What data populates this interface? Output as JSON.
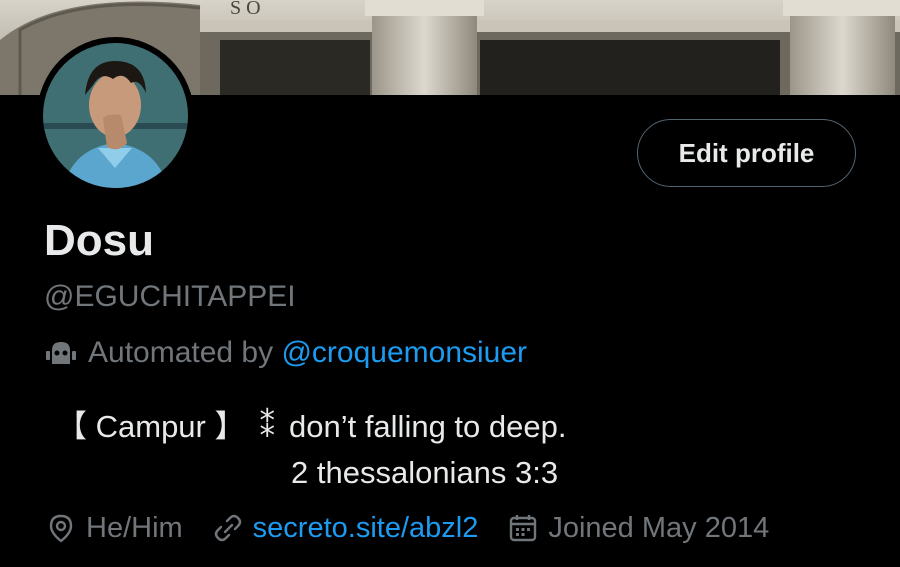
{
  "profile": {
    "name": "Dosu",
    "handle": "@EGUCHITAPPEI",
    "automated_prefix": "Automated by",
    "automated_by": "@croquemonsiuer",
    "bio_line1_a": "【 Campur 】",
    "bio_glyph": "⁑",
    "bio_line1_b": "don’t falling to deep.",
    "bio_line2": "2 thessalonians 3:3",
    "pronouns": "He/Him",
    "website": "secreto.site/abzl2",
    "joined": "Joined May 2014"
  },
  "actions": {
    "edit_profile_label": "Edit profile"
  },
  "icons": {
    "automated": "robot-icon",
    "location": "location-pin-icon",
    "website": "link-icon",
    "joined": "calendar-icon"
  },
  "colors": {
    "background": "#000000",
    "text_primary": "#e7e9ea",
    "text_secondary": "#71767b",
    "accent": "#1d9bf0",
    "button_border": "#536471"
  }
}
